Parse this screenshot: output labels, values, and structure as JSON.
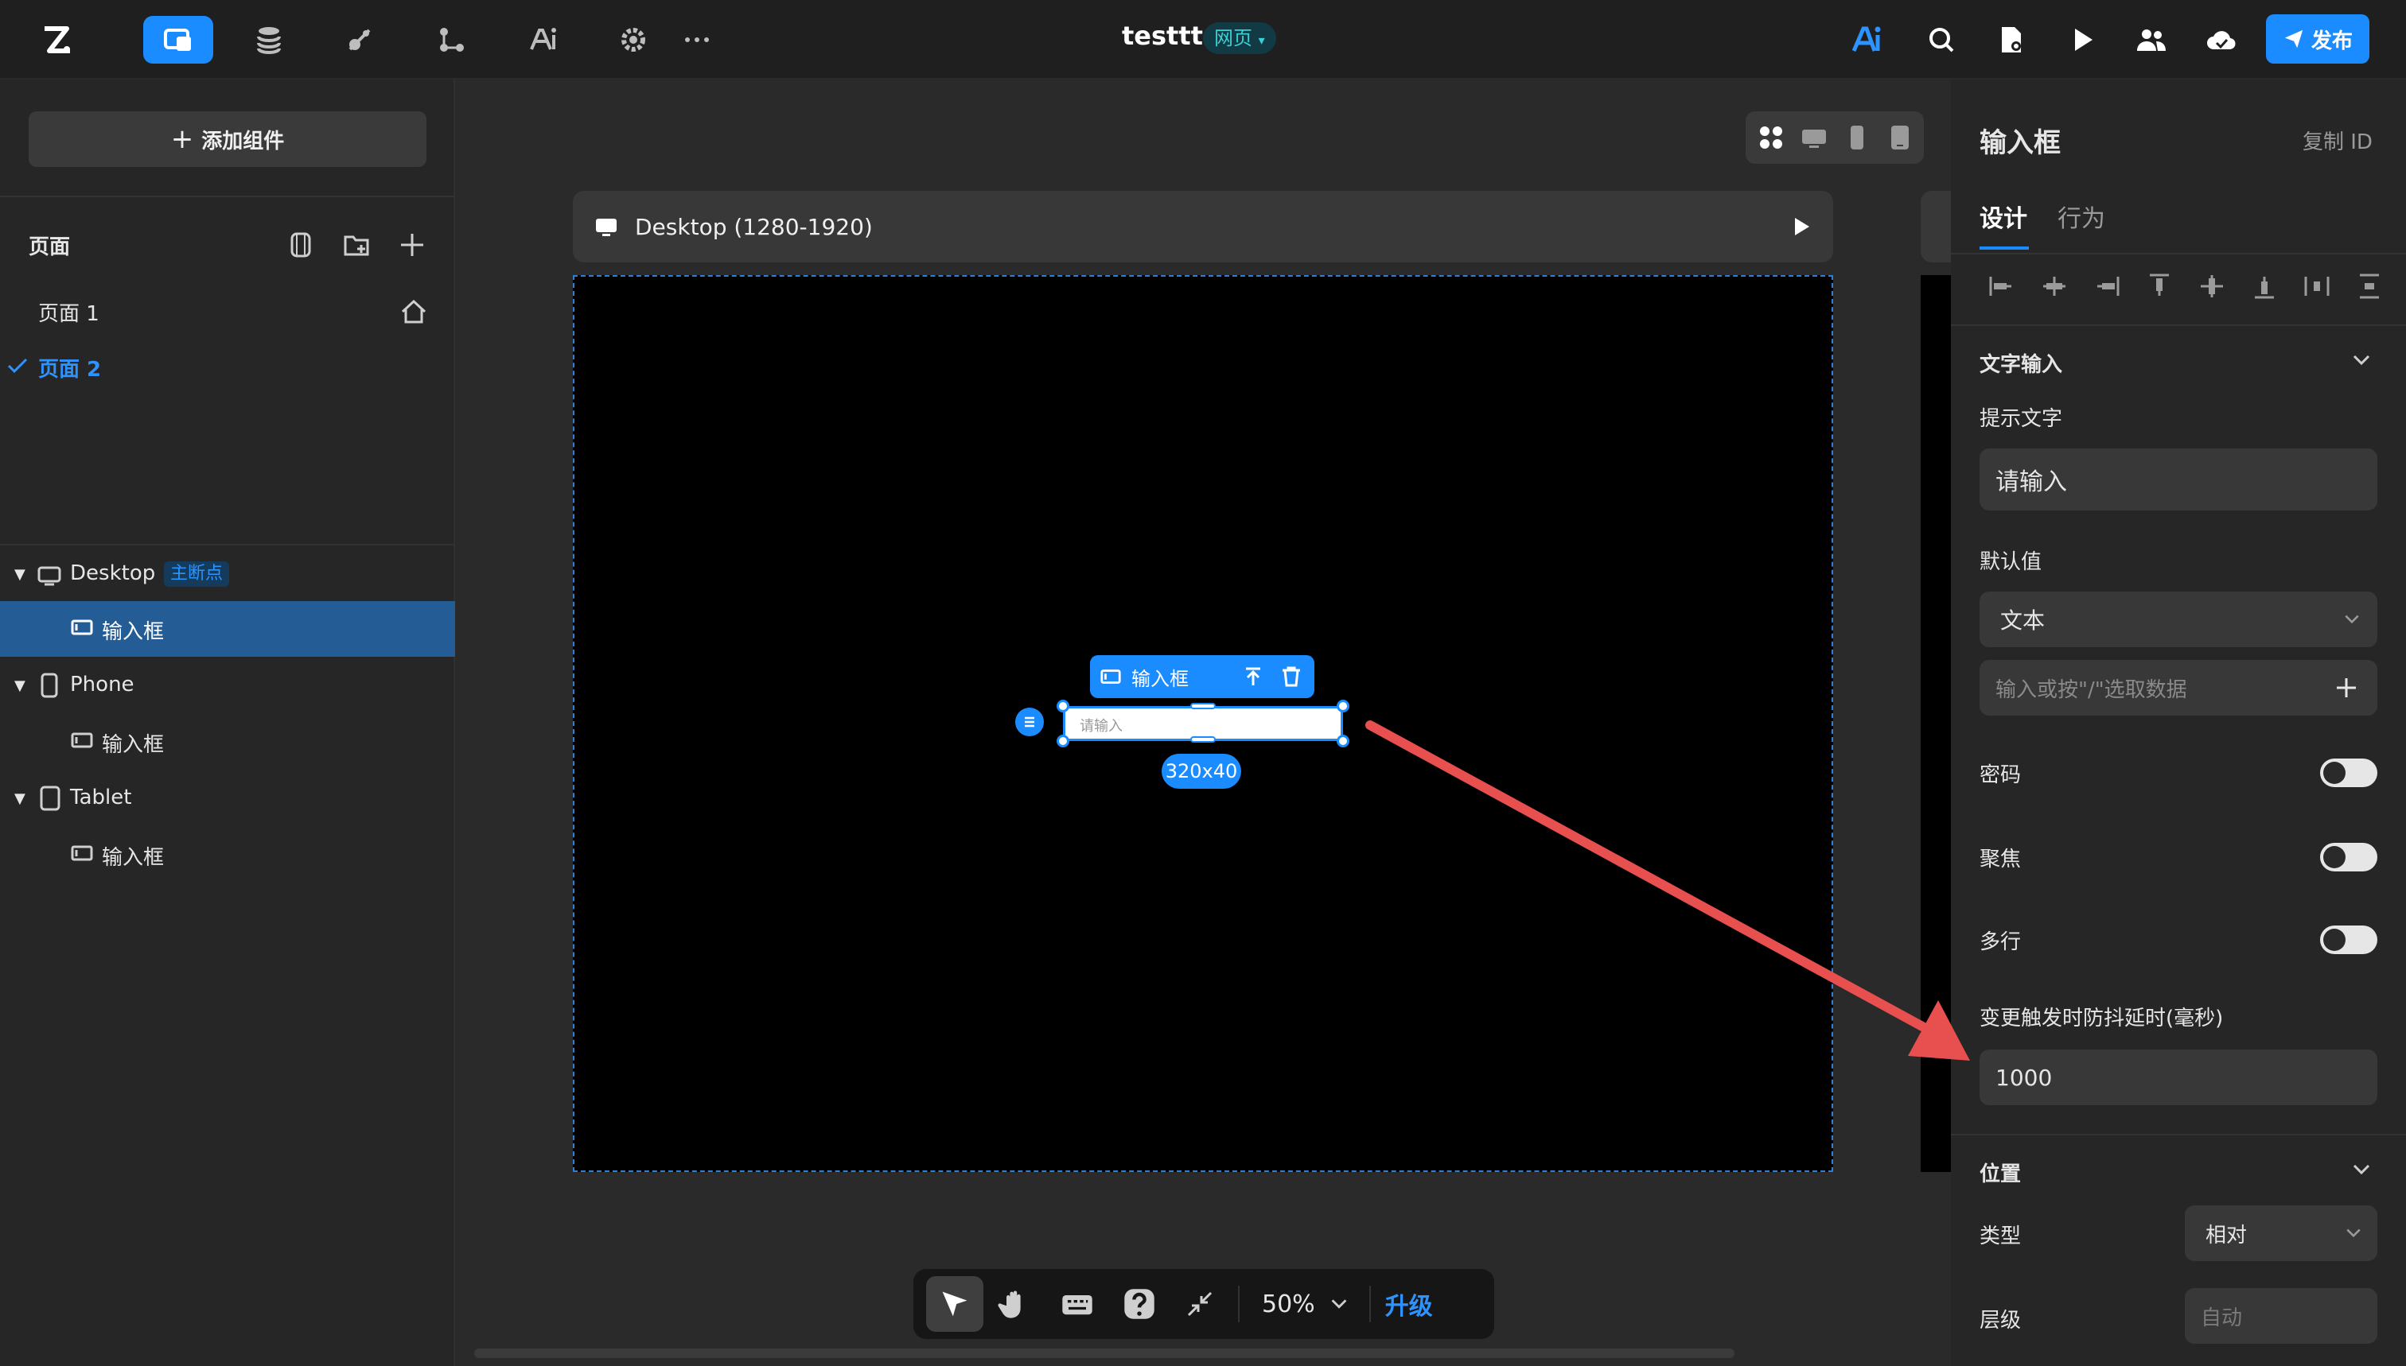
{
  "topbar": {
    "project_title": "testtt",
    "project_type": "网页",
    "publish_label": "发布"
  },
  "sidebar": {
    "add_component_label": "添加组件",
    "pages_header": "页面",
    "pages": [
      {
        "label": "页面 1",
        "selected": false
      },
      {
        "label": "页面 2",
        "selected": true
      }
    ],
    "layers": [
      {
        "label": "Desktop",
        "badge": "主断点",
        "children": [
          "输入框"
        ]
      },
      {
        "label": "Phone",
        "children": [
          "输入框"
        ]
      },
      {
        "label": "Tablet",
        "children": [
          "输入框"
        ]
      }
    ]
  },
  "canvas": {
    "frame_label": "Desktop (1280-1920)",
    "selected_element_label": "输入框",
    "input_placeholder": "请输入",
    "element_size": "320x40",
    "zoom": "50%",
    "upgrade_label": "升级"
  },
  "props": {
    "title": "输入框",
    "copy_id_label": "复制 ID",
    "tabs": [
      {
        "label": "设计",
        "active": true
      },
      {
        "label": "行为",
        "active": false
      }
    ],
    "section_text_input": "文字输入",
    "hint_label": "提示文字",
    "hint_value": "请输入",
    "default_label": "默认值",
    "default_type": "文本",
    "default_placeholder": "输入或按\"/\"选取数据",
    "password_label": "密码",
    "focus_label": "聚焦",
    "multiline_label": "多行",
    "debounce_label": "变更触发时防抖延时(毫秒)",
    "debounce_value": "1000",
    "section_position": "位置",
    "type_label": "类型",
    "type_value": "相对",
    "layer_label": "层级",
    "layer_placeholder": "自动"
  },
  "colors": {
    "accent": "#1a8cff",
    "annotation_arrow": "#e8504f"
  }
}
